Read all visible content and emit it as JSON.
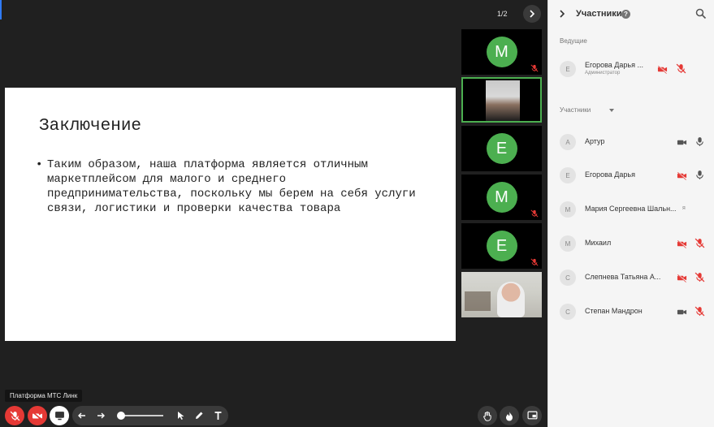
{
  "stage": {
    "page_counter": "1/2",
    "slide": {
      "title": "Заключение",
      "bullet": "Таким образом, наша платформа является отличным маркетплейсом для малого и среднего предпринимательства, поскольку мы берем на себя услуги связи, логистики и проверки качества товара"
    },
    "tiles": [
      {
        "type": "avatar",
        "letter": "M",
        "mic": "mic-off-icon"
      },
      {
        "type": "video",
        "active": true
      },
      {
        "type": "avatar",
        "letter": "E",
        "mic": null
      },
      {
        "type": "avatar",
        "letter": "M",
        "mic": "mic-off-icon"
      },
      {
        "type": "avatar",
        "letter": "E",
        "mic": "mic-off-icon"
      },
      {
        "type": "video",
        "active": false
      }
    ],
    "tooltip": "Платформа МТС Линк"
  },
  "panel": {
    "title": "Участники",
    "help_glyph": "?",
    "hosts_label": "Ведущие",
    "participants_label": "Участники",
    "hosts": [
      {
        "initial": "Е",
        "name": "Егорова Дарья ...",
        "role": "Администратор",
        "camera": "off",
        "mic": "off"
      }
    ],
    "participants": [
      {
        "initial": "А",
        "name": "Артур",
        "camera": "on",
        "mic": "on",
        "me": ""
      },
      {
        "initial": "Е",
        "name": "Егорова Дарья",
        "camera": "off",
        "mic": "on",
        "me": ""
      },
      {
        "initial": "М",
        "name": "Мария Сергеевна Шальн...",
        "camera": "none",
        "mic": "none",
        "me": "я"
      },
      {
        "initial": "М",
        "name": "Михаил",
        "camera": "off",
        "mic": "off",
        "me": ""
      },
      {
        "initial": "С",
        "name": "Слепнева Татьяна А...",
        "camera": "off",
        "mic": "off",
        "me": ""
      },
      {
        "initial": "С",
        "name": "Степан Мандрон",
        "camera": "on",
        "mic": "off",
        "me": ""
      }
    ]
  },
  "colors": {
    "accent_green": "#4caf50",
    "danger_red": "#e53935",
    "stage_bg": "#202020",
    "panel_bg": "#f5f5f5",
    "top_accent": "#2f7bf5"
  }
}
